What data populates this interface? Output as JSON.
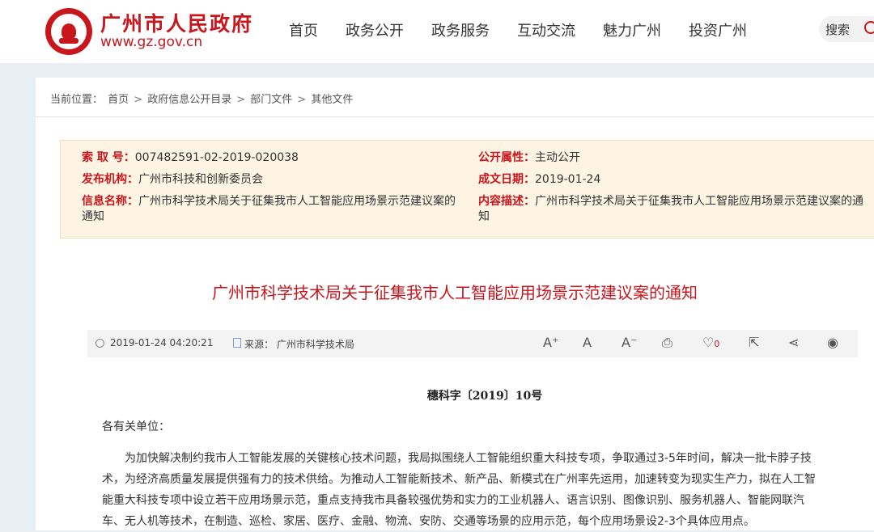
{
  "header": {
    "site_title": "广州市人民政府",
    "site_url": "www.gz.gov.cn",
    "nav": [
      "首页",
      "政务公开",
      "政务服务",
      "互动交流",
      "魅力广州",
      "投资广州"
    ],
    "search_label": "搜索"
  },
  "breadcrumb": {
    "prefix": "当前位置：",
    "items": [
      "首页",
      "政府信息公开目录",
      "部门文件",
      "其他文件"
    ]
  },
  "info": {
    "index_label": "索 取 号：",
    "index_value": "007482591-02-2019-020038",
    "publisher_label": "发布机构：",
    "publisher_value": "广州市科技和创新委员会",
    "name_label": "信息名称：",
    "name_value": "广州市科学技术局关于征集我市人工智能应用场景示范建议案的通知",
    "attr_label": "公开属性：",
    "attr_value": "主动公开",
    "date_label": "成文日期：",
    "date_value": "2019-01-24",
    "desc_label": "内容描述：",
    "desc_value": "广州市科学技术局关于征集我市人工智能应用场景示范建议案的通知"
  },
  "doc": {
    "title": "广州市科学技术局关于征集我市人工智能应用场景示范建议案的通知",
    "datetime": "2019-01-24 04:20:21",
    "source": "来源： 广州市科学技术局",
    "like_count": "0",
    "number": "穗科字〔2019〕10号",
    "greeting": "各有关单位：",
    "para1_l1": "为加快解决制约我市人工智能发展的关键核心技术问题，我局拟围绕人工智能组织重大科技专项，争取通过3-5年时间，解决一批卡脖子技",
    "para1_l2": "术，为经济高质量发展提供强有力的技术供给。为推动人工智能新技术、新产品、新模式在广州率先运用，加速转变为现实生产力，拟在人工智",
    "para1_l3": "能重大科技专项中设立若干应用场景示范，重点支持我市具备较强优势和实力的工业机器人、语言识别、图像识别、服务机器人、智能网联汽",
    "para1_l4": "车、无人机等技术，在制造、巡检、家居、医疗、金融、物流、安防、交通等场景的应用示范，每个应用场景设2-3个具体应用点。"
  },
  "icons": {
    "font_increase": "A⁺",
    "font_normal": "A",
    "font_decrease": "A⁻",
    "print": "⎙",
    "heart": "♡",
    "share_box": "⇱",
    "share": "⋖",
    "view": "◉"
  }
}
